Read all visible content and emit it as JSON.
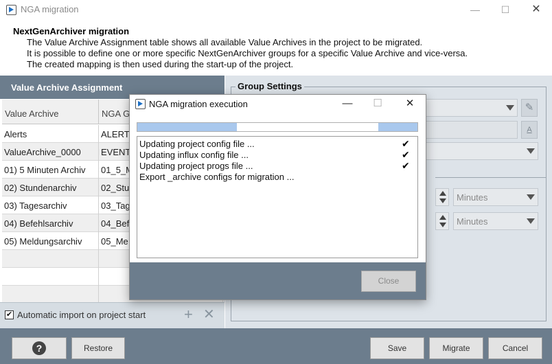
{
  "window": {
    "title": "NGA migration",
    "minimize": "—",
    "maximize": "☐",
    "close": "✕"
  },
  "header": {
    "title": "NextGenArchiver migration",
    "lines": [
      "The Value Archive Assignment table shows all available Value Archives in the project to be migrated.",
      "It is possible to define one or more specific NextGenArchiver groups for a specific Value Archive and vice-versa.",
      "The created mapping is then used during the start-up of the project."
    ]
  },
  "value_archive_panel": {
    "title": "Value Archive Assignment",
    "columns": [
      "Value Archive",
      "NGA G"
    ],
    "rows": [
      [
        "Alerts",
        "ALERT"
      ],
      [
        "ValueArchive_0000",
        "EVENT"
      ],
      [
        "01) 5 Minuten Archiv",
        "01_5_M"
      ],
      [
        "02) Stundenarchiv",
        "02_Stu"
      ],
      [
        "03) Tagesarchiv",
        "03_Tag"
      ],
      [
        "04) Befehlsarchiv",
        "04_Bef"
      ],
      [
        "05) Meldungsarchiv",
        "05_Me"
      ],
      [
        "",
        ""
      ],
      [
        "",
        ""
      ],
      [
        "",
        ""
      ]
    ],
    "auto_import_label": "Automatic import on project start",
    "auto_import_checked": "✔",
    "add_icon": "+",
    "remove_icon": "✕"
  },
  "group_settings": {
    "title": "Group Settings",
    "unit_1": "Minutes",
    "unit_2": "Minutes",
    "edit_icon": "✎",
    "translate_icon": "A"
  },
  "bottom": {
    "help": "?",
    "restore": "Restore",
    "save": "Save",
    "migrate": "Migrate",
    "cancel": "Cancel"
  },
  "dialog": {
    "title": "NGA migration execution",
    "minimize": "—",
    "maximize": "☐",
    "close": "✕",
    "progress_segments": [
      [
        0,
        0.355
      ],
      [
        0.86,
        1.0
      ]
    ],
    "log": [
      {
        "text": "Updating project config file ...",
        "check": "✔"
      },
      {
        "text": "Updating influx config file ...",
        "check": "✔"
      },
      {
        "text": "Updating project progs file ...",
        "check": "✔"
      },
      {
        "text": "Export _archive configs for migration ...",
        "check": ""
      }
    ],
    "close_button": "Close"
  }
}
